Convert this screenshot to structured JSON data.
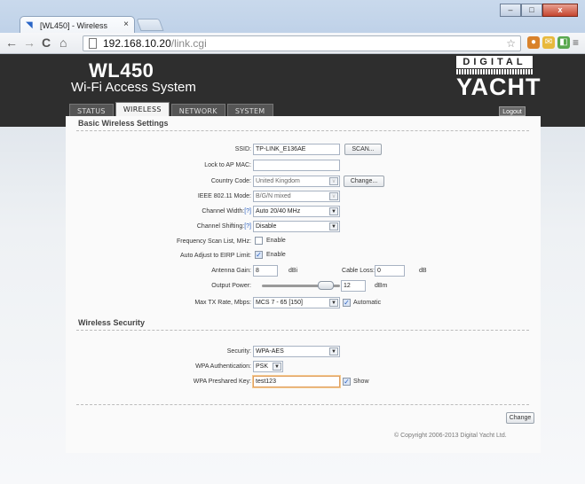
{
  "browser": {
    "tab_title": "[WL450] - Wireless",
    "tab_close": "×",
    "url_host": "192.168.10.20",
    "url_path": "/link.cgi"
  },
  "header": {
    "product": "WL450",
    "subtitle": "Wi-Fi Access System",
    "logo_top": "DIGITAL",
    "logo_bottom": "YACHT",
    "logout": "Logout"
  },
  "nav_tabs": [
    {
      "label": "STATUS",
      "active": false
    },
    {
      "label": "WIRELESS",
      "active": true
    },
    {
      "label": "NETWORK",
      "active": false
    },
    {
      "label": "SYSTEM",
      "active": false
    }
  ],
  "basic": {
    "title": "Basic Wireless Settings",
    "ssid_label": "SSID:",
    "ssid_value": "TP-LINK_E136AE",
    "scan_button": "SCAN...",
    "lock_ap_label": "Lock to AP MAC:",
    "lock_ap_value": "",
    "country_label": "Country Code:",
    "country_value": "United Kingdom",
    "change_country_button": "Change...",
    "mode_label": "IEEE 802.11 Mode:",
    "mode_value": "B/G/N mixed",
    "width_label": "Channel Width:",
    "width_help": "[?]",
    "width_value": "Auto 20/40 MHz",
    "shift_label": "Channel Shifting:",
    "shift_help": "[?]",
    "shift_value": "Disable",
    "scanlist_label": "Frequency Scan List, MHz:",
    "scanlist_enable": "Enable",
    "scanlist_checked": false,
    "eirp_label": "Auto Adjust to EIRP Limit:",
    "eirp_enable": "Enable",
    "eirp_checked": true,
    "antenna_label": "Antenna Gain:",
    "antenna_value": "8",
    "antenna_unit": "dBi",
    "cable_label": "Cable Loss:",
    "cable_value": "0",
    "cable_unit": "dB",
    "power_label": "Output Power:",
    "power_value": "12",
    "power_unit": "dBm",
    "power_fraction": 0.9,
    "rate_label": "Max TX Rate, Mbps:",
    "rate_value": "MCS 7 - 65 [150]",
    "rate_auto": "Automatic",
    "rate_auto_checked": true
  },
  "security": {
    "title": "Wireless Security",
    "security_label": "Security:",
    "security_value": "WPA-AES",
    "auth_label": "WPA Authentication:",
    "auth_value": "PSK",
    "key_label": "WPA Preshared Key:",
    "key_value": "test123",
    "show_label": "Show",
    "show_checked": true
  },
  "change_button": "Change",
  "footer": "© Copyright 2006-2013 Digital Yacht Ltd."
}
